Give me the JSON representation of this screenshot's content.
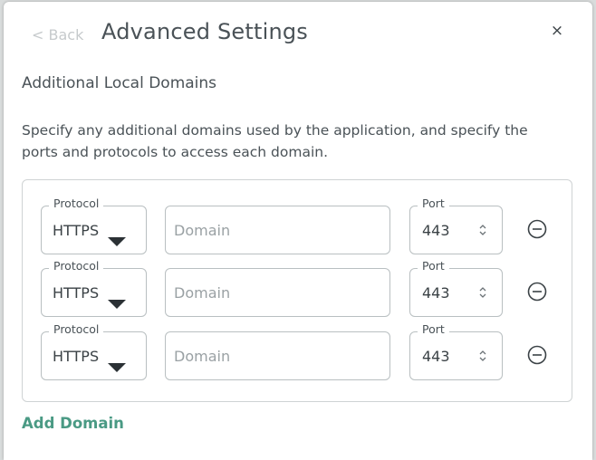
{
  "header": {
    "back_label": "< Back",
    "title": "Advanced Settings",
    "close_label": "×"
  },
  "section": {
    "title": "Additional Local Domains",
    "description": "Specify any additional domains used by the application, and specify the ports and protocols to access each domain."
  },
  "labels": {
    "protocol": "Protocol",
    "port": "Port"
  },
  "rows": [
    {
      "protocol": "HTTPS",
      "domain_placeholder": "Domain",
      "domain_value": "",
      "port": "443"
    },
    {
      "protocol": "HTTPS",
      "domain_placeholder": "Domain",
      "domain_value": "",
      "port": "443"
    },
    {
      "protocol": "HTTPS",
      "domain_placeholder": "Domain",
      "domain_value": "",
      "port": "443"
    }
  ],
  "actions": {
    "add_domain_label": "Add Domain"
  },
  "icons": {
    "remove": "minus-circle-icon",
    "spinner": "stepper-icon",
    "dropdown": "caret-down-icon",
    "close": "close-icon"
  },
  "colors": {
    "accent": "#4a9a84",
    "text": "#3b4246",
    "muted": "#c6cacc",
    "border": "#b9bfc1"
  }
}
